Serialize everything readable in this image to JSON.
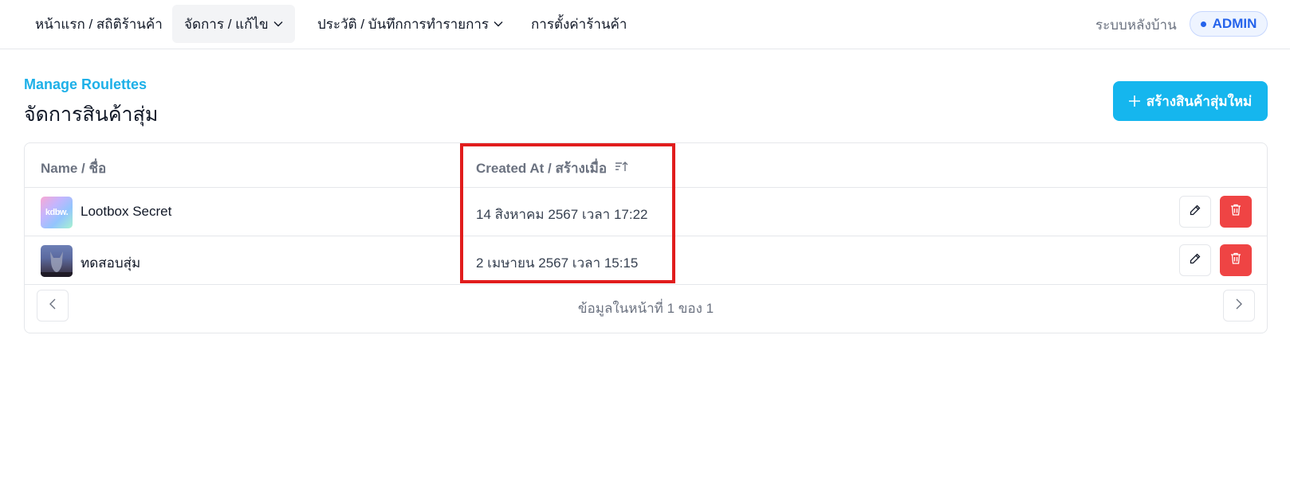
{
  "nav": {
    "items": [
      {
        "label": "หน้าแรก / สถิติร้านค้า",
        "has_dropdown": false
      },
      {
        "label": "จัดการ / แก้ไข",
        "has_dropdown": true,
        "active": true
      },
      {
        "label": "ประวัติ / บันทึกการทำรายการ",
        "has_dropdown": true
      },
      {
        "label": "การตั้งค่าร้านค้า",
        "has_dropdown": false
      }
    ],
    "backend_label": "ระบบหลังบ้าน",
    "role_badge": "ADMIN"
  },
  "header": {
    "subtitle": "Manage Roulettes",
    "title": "จัดการสินค้าสุ่ม",
    "create_button": "สร้างสินค้าสุ่มใหม่"
  },
  "table": {
    "columns": [
      "Name / ชื่อ",
      "Created At / สร้างเมื่อ"
    ],
    "rows": [
      {
        "name": "Lootbox Secret",
        "created_at": "14 สิงหาคม 2567 เวลา 17:22",
        "thumb_text": "kdbw."
      },
      {
        "name": "ทดสอบสุ่ม",
        "created_at": "2 เมษายน 2567 เวลา 15:15",
        "thumb_text": ""
      }
    ]
  },
  "pagination": {
    "text": "ข้อมูลในหน้าที่ 1 ของ 1"
  },
  "icons": {
    "chevron": "chevron-down-icon",
    "sort": "sort-ascending-icon",
    "edit": "pencil-icon",
    "delete": "trash-icon",
    "prev": "chevron-left-icon",
    "next": "chevron-right-icon",
    "plus": "plus-icon"
  },
  "colors": {
    "accent": "#15b6ee",
    "subtitle": "#1db0e8",
    "danger": "#ef4444",
    "admin": "#2563eb",
    "highlight": "#e11d1d"
  }
}
